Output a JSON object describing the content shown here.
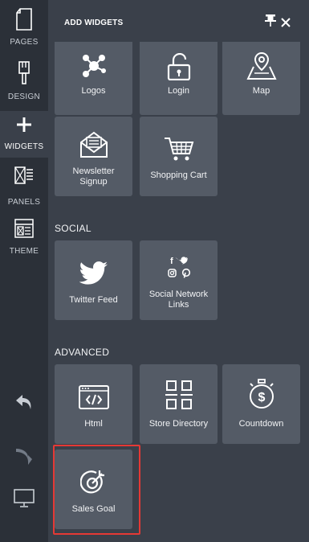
{
  "rail": {
    "items": [
      {
        "label": "PAGES",
        "icon": "page-icon"
      },
      {
        "label": "DESIGN",
        "icon": "brush-icon"
      },
      {
        "label": "WIDGETS",
        "icon": "plus-icon"
      },
      {
        "label": "PANELS",
        "icon": "panels-icon"
      },
      {
        "label": "THEME",
        "icon": "theme-icon"
      }
    ],
    "tools": [
      "undo-icon",
      "redo-icon",
      "desktop-preview-icon"
    ]
  },
  "panel": {
    "title": "ADD WIDGETS",
    "pin_icon": "pin-icon",
    "close_icon": "close-icon"
  },
  "widgets_top": [
    {
      "label": "Logos",
      "icon": "logos-icon"
    },
    {
      "label": "Login",
      "icon": "padlock-icon"
    },
    {
      "label": "Map",
      "icon": "map-icon"
    },
    {
      "label": "Newsletter Signup",
      "icon": "envelope-icon"
    },
    {
      "label": "Shopping Cart",
      "icon": "cart-icon"
    }
  ],
  "social": {
    "title": "SOCIAL",
    "items": [
      {
        "label": "Twitter Feed",
        "icon": "twitter-icon"
      },
      {
        "label": "Social Network Links",
        "icon": "social-links-icon"
      }
    ]
  },
  "advanced": {
    "title": "ADVANCED",
    "items": [
      {
        "label": "Html",
        "icon": "code-icon"
      },
      {
        "label": "Store Directory",
        "icon": "directory-icon"
      },
      {
        "label": "Countdown",
        "icon": "stopwatch-icon"
      },
      {
        "label": "Sales Goal",
        "icon": "target-icon"
      }
    ]
  },
  "colors": {
    "rail_bg": "#2b3038",
    "panel_bg": "#3a404a",
    "tile_bg": "#545b66",
    "highlight": "#e53935"
  }
}
